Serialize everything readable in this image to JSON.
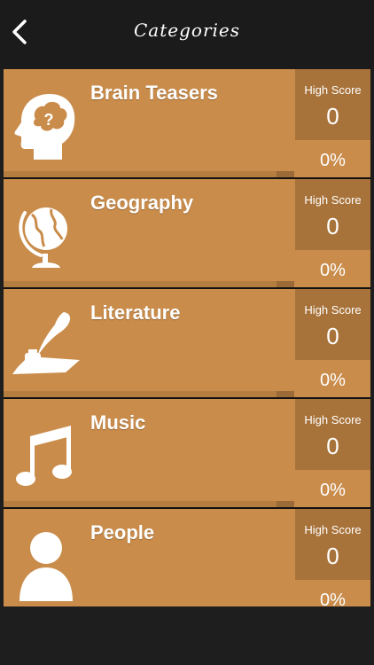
{
  "nav": {
    "title": "Categories",
    "back_icon": "chevron-left-icon"
  },
  "colors": {
    "row_bg": "#c98c4b",
    "score_bg": "#a8733a",
    "nav_bg": "#1b1b1b"
  },
  "categories": [
    {
      "name": "Brain Teasers",
      "icon": "brain-head-icon",
      "score_label": "High Score",
      "score": "0",
      "percent": "0%"
    },
    {
      "name": "Geography",
      "icon": "globe-icon",
      "score_label": "High Score",
      "score": "0",
      "percent": "0%"
    },
    {
      "name": "Literature",
      "icon": "quill-inkwell-icon",
      "score_label": "High Score",
      "score": "0",
      "percent": "0%"
    },
    {
      "name": "Music",
      "icon": "music-note-icon",
      "score_label": "High Score",
      "score": "0",
      "percent": "0%"
    },
    {
      "name": "People",
      "icon": "person-icon",
      "score_label": "High Score",
      "score": "0",
      "percent": "0%"
    }
  ]
}
